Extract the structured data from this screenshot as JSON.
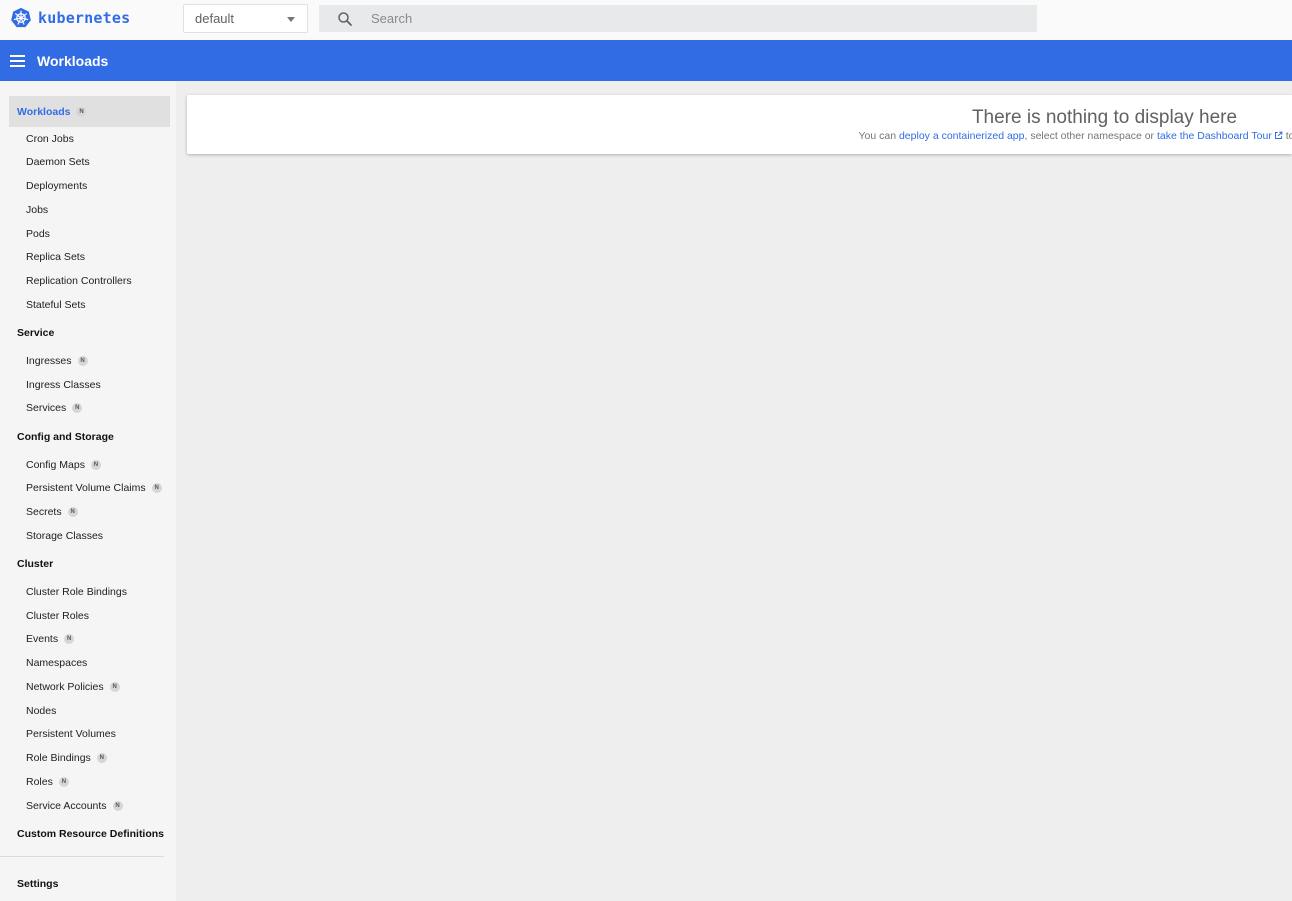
{
  "brand": {
    "name": "kubernetes"
  },
  "namespace": {
    "selected": "default"
  },
  "search": {
    "placeholder": "Search"
  },
  "appbar": {
    "title": "Workloads"
  },
  "sidebar": {
    "badge_label": "N",
    "sections": [
      {
        "title": "Workloads",
        "badge": true,
        "active": true,
        "items": [
          {
            "label": "Cron Jobs",
            "badge": false
          },
          {
            "label": "Daemon Sets",
            "badge": false
          },
          {
            "label": "Deployments",
            "badge": false
          },
          {
            "label": "Jobs",
            "badge": false
          },
          {
            "label": "Pods",
            "badge": false
          },
          {
            "label": "Replica Sets",
            "badge": false
          },
          {
            "label": "Replication Controllers",
            "badge": false
          },
          {
            "label": "Stateful Sets",
            "badge": false
          }
        ]
      },
      {
        "title": "Service",
        "badge": false,
        "items": [
          {
            "label": "Ingresses",
            "badge": true
          },
          {
            "label": "Ingress Classes",
            "badge": false
          },
          {
            "label": "Services",
            "badge": true
          }
        ]
      },
      {
        "title": "Config and Storage",
        "badge": false,
        "items": [
          {
            "label": "Config Maps",
            "badge": true
          },
          {
            "label": "Persistent Volume Claims",
            "badge": true
          },
          {
            "label": "Secrets",
            "badge": true
          },
          {
            "label": "Storage Classes",
            "badge": false
          }
        ]
      },
      {
        "title": "Cluster",
        "badge": false,
        "items": [
          {
            "label": "Cluster Role Bindings",
            "badge": false
          },
          {
            "label": "Cluster Roles",
            "badge": false
          },
          {
            "label": "Events",
            "badge": true
          },
          {
            "label": "Namespaces",
            "badge": false
          },
          {
            "label": "Network Policies",
            "badge": true
          },
          {
            "label": "Nodes",
            "badge": false
          },
          {
            "label": "Persistent Volumes",
            "badge": false
          },
          {
            "label": "Role Bindings",
            "badge": true
          },
          {
            "label": "Roles",
            "badge": true
          },
          {
            "label": "Service Accounts",
            "badge": true
          }
        ]
      },
      {
        "title": "Custom Resource Definitions",
        "badge": false,
        "items": []
      }
    ],
    "settings_label": "Settings"
  },
  "empty_state": {
    "title": "There is nothing to display here",
    "text_1": "You can ",
    "link_deploy": "deploy a containerized app",
    "text_2": ", select other namespace or ",
    "link_tour": "take the Dashboard Tour",
    "text_3": " to learn more."
  },
  "colors": {
    "accent": "#326ce5",
    "background": "#eeeeee",
    "sidebar": "#f5f5f5"
  }
}
